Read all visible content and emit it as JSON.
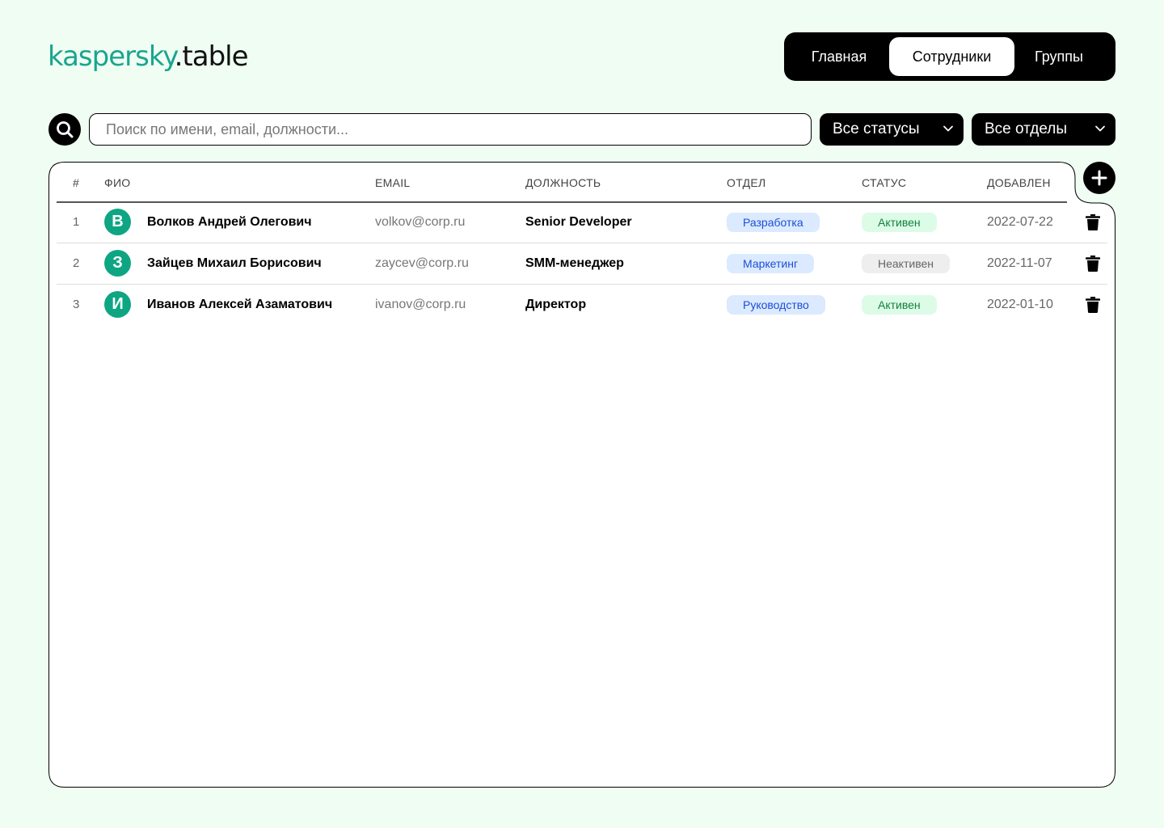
{
  "app": {
    "logo_brand": "kaspersky",
    "logo_suffix": ".table"
  },
  "nav": {
    "tabs": [
      {
        "label": "Главная",
        "active": false
      },
      {
        "label": "Сотрудники",
        "active": true
      },
      {
        "label": "Группы",
        "active": false
      }
    ]
  },
  "toolbar": {
    "search_placeholder": "Поиск по имени, email, должности...",
    "search_value": "",
    "status_filter": "Все статусы",
    "dept_filter": "Все отделы"
  },
  "table": {
    "columns": {
      "num": "#",
      "name": "ФИО",
      "email": "EMAIL",
      "position": "ДОЛЖНОСТЬ",
      "department": "ОТДЕЛ",
      "status": "СТАТУС",
      "added": "ДОБАВЛЕН"
    },
    "rows": [
      {
        "num": "1",
        "initial": "В",
        "name": "Волков Андрей Олегович",
        "email": "volkov@corp.ru",
        "position": "Senior Developer",
        "department": "Разработка",
        "status": "Активен",
        "added": "2022-07-22"
      },
      {
        "num": "2",
        "initial": "З",
        "name": "Зайцев Михаил Борисович",
        "email": "zaycev@corp.ru",
        "position": "SMM-менеджер",
        "department": "Маркетинг",
        "status": "Неактивен",
        "added": "2022-11-07"
      },
      {
        "num": "3",
        "initial": "И",
        "name": "Иванов Алексей Азаматович",
        "email": "ivanov@corp.ru",
        "position": "Директор",
        "department": "Руководство",
        "status": "Активен",
        "added": "2022-01-10"
      }
    ]
  },
  "colors": {
    "background": "#f0fdf2",
    "brand": "#1aa58f",
    "avatar": "#0ea583",
    "active_badge_bg": "#dcfce7",
    "dept_badge_bg": "#dbeafe"
  },
  "icons": {
    "search": "search-icon",
    "add": "plus-icon",
    "delete": "trash-icon",
    "dropdown": "chevron-down-icon"
  }
}
